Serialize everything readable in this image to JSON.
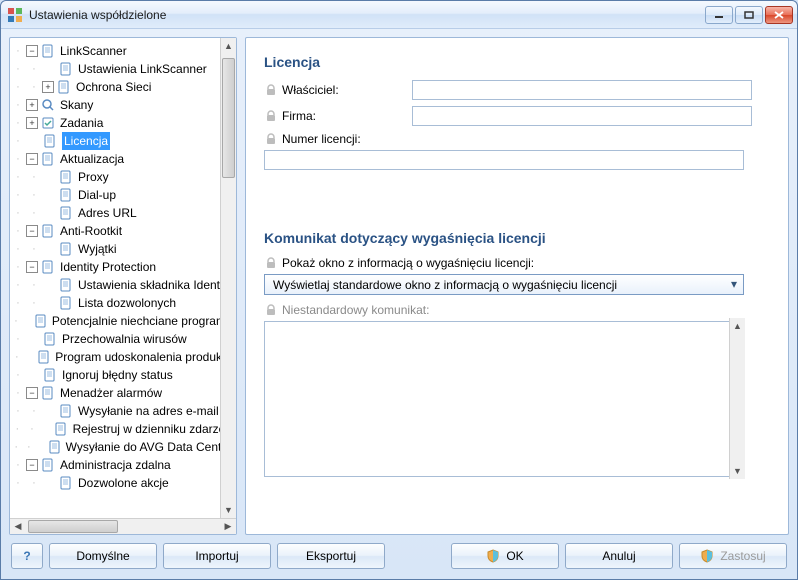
{
  "window": {
    "title": "Ustawienia współdzielone"
  },
  "tree": [
    {
      "depth": 1,
      "expander": "-",
      "icon": "page",
      "label": "LinkScanner"
    },
    {
      "depth": 2,
      "expander": "",
      "icon": "page",
      "label": "Ustawienia LinkScanner"
    },
    {
      "depth": 2,
      "expander": "+",
      "icon": "page",
      "label": "Ochrona Sieci"
    },
    {
      "depth": 1,
      "expander": "+",
      "icon": "scan",
      "label": "Skany"
    },
    {
      "depth": 1,
      "expander": "+",
      "icon": "task",
      "label": "Zadania"
    },
    {
      "depth": 1,
      "expander": "",
      "icon": "page",
      "label": "Licencja",
      "selected": true
    },
    {
      "depth": 1,
      "expander": "-",
      "icon": "page",
      "label": "Aktualizacja"
    },
    {
      "depth": 2,
      "expander": "",
      "icon": "page",
      "label": "Proxy"
    },
    {
      "depth": 2,
      "expander": "",
      "icon": "page",
      "label": "Dial-up"
    },
    {
      "depth": 2,
      "expander": "",
      "icon": "page",
      "label": "Adres URL"
    },
    {
      "depth": 1,
      "expander": "-",
      "icon": "page",
      "label": "Anti-Rootkit"
    },
    {
      "depth": 2,
      "expander": "",
      "icon": "page",
      "label": "Wyjątki"
    },
    {
      "depth": 1,
      "expander": "-",
      "icon": "page",
      "label": "Identity Protection"
    },
    {
      "depth": 2,
      "expander": "",
      "icon": "page",
      "label": "Ustawienia składnika Identity"
    },
    {
      "depth": 2,
      "expander": "",
      "icon": "page",
      "label": "Lista dozwolonych"
    },
    {
      "depth": 1,
      "expander": "",
      "icon": "page",
      "label": "Potencjalnie niechciane programy"
    },
    {
      "depth": 1,
      "expander": "",
      "icon": "page",
      "label": "Przechowalnia wirusów"
    },
    {
      "depth": 1,
      "expander": "",
      "icon": "page",
      "label": "Program udoskonalenia produktu"
    },
    {
      "depth": 1,
      "expander": "",
      "icon": "page",
      "label": "Ignoruj błędny status"
    },
    {
      "depth": 1,
      "expander": "-",
      "icon": "page",
      "label": "Menadżer alarmów"
    },
    {
      "depth": 2,
      "expander": "",
      "icon": "page",
      "label": "Wysyłanie na adres e-mail"
    },
    {
      "depth": 2,
      "expander": "",
      "icon": "page",
      "label": "Rejestruj w dzienniku zdarzeń"
    },
    {
      "depth": 2,
      "expander": "",
      "icon": "page",
      "label": "Wysyłanie do AVG Data Center"
    },
    {
      "depth": 1,
      "expander": "-",
      "icon": "page",
      "label": "Administracja zdalna"
    },
    {
      "depth": 2,
      "expander": "",
      "icon": "page",
      "label": "Dozwolone akcje"
    }
  ],
  "license": {
    "section_title": "Licencja",
    "owner_label": "Właściciel:",
    "owner_value": "",
    "company_label": "Firma:",
    "company_value": "",
    "number_label": "Numer licencji:",
    "number_value": ""
  },
  "expiry": {
    "section_title": "Komunikat dotyczący wygaśnięcia licencji",
    "show_window_label": "Pokaż okno z informacją o wygaśnięciu licencji:",
    "selected_option": "Wyświetlaj standardowe okno z informacją o wygaśnięciu licencji",
    "custom_label": "Niestandardowy komunikat:",
    "custom_value": ""
  },
  "buttons": {
    "defaults": "Domyślne",
    "import": "Importuj",
    "export": "Eksportuj",
    "ok": "OK",
    "cancel": "Anuluj",
    "apply": "Zastosuj"
  }
}
